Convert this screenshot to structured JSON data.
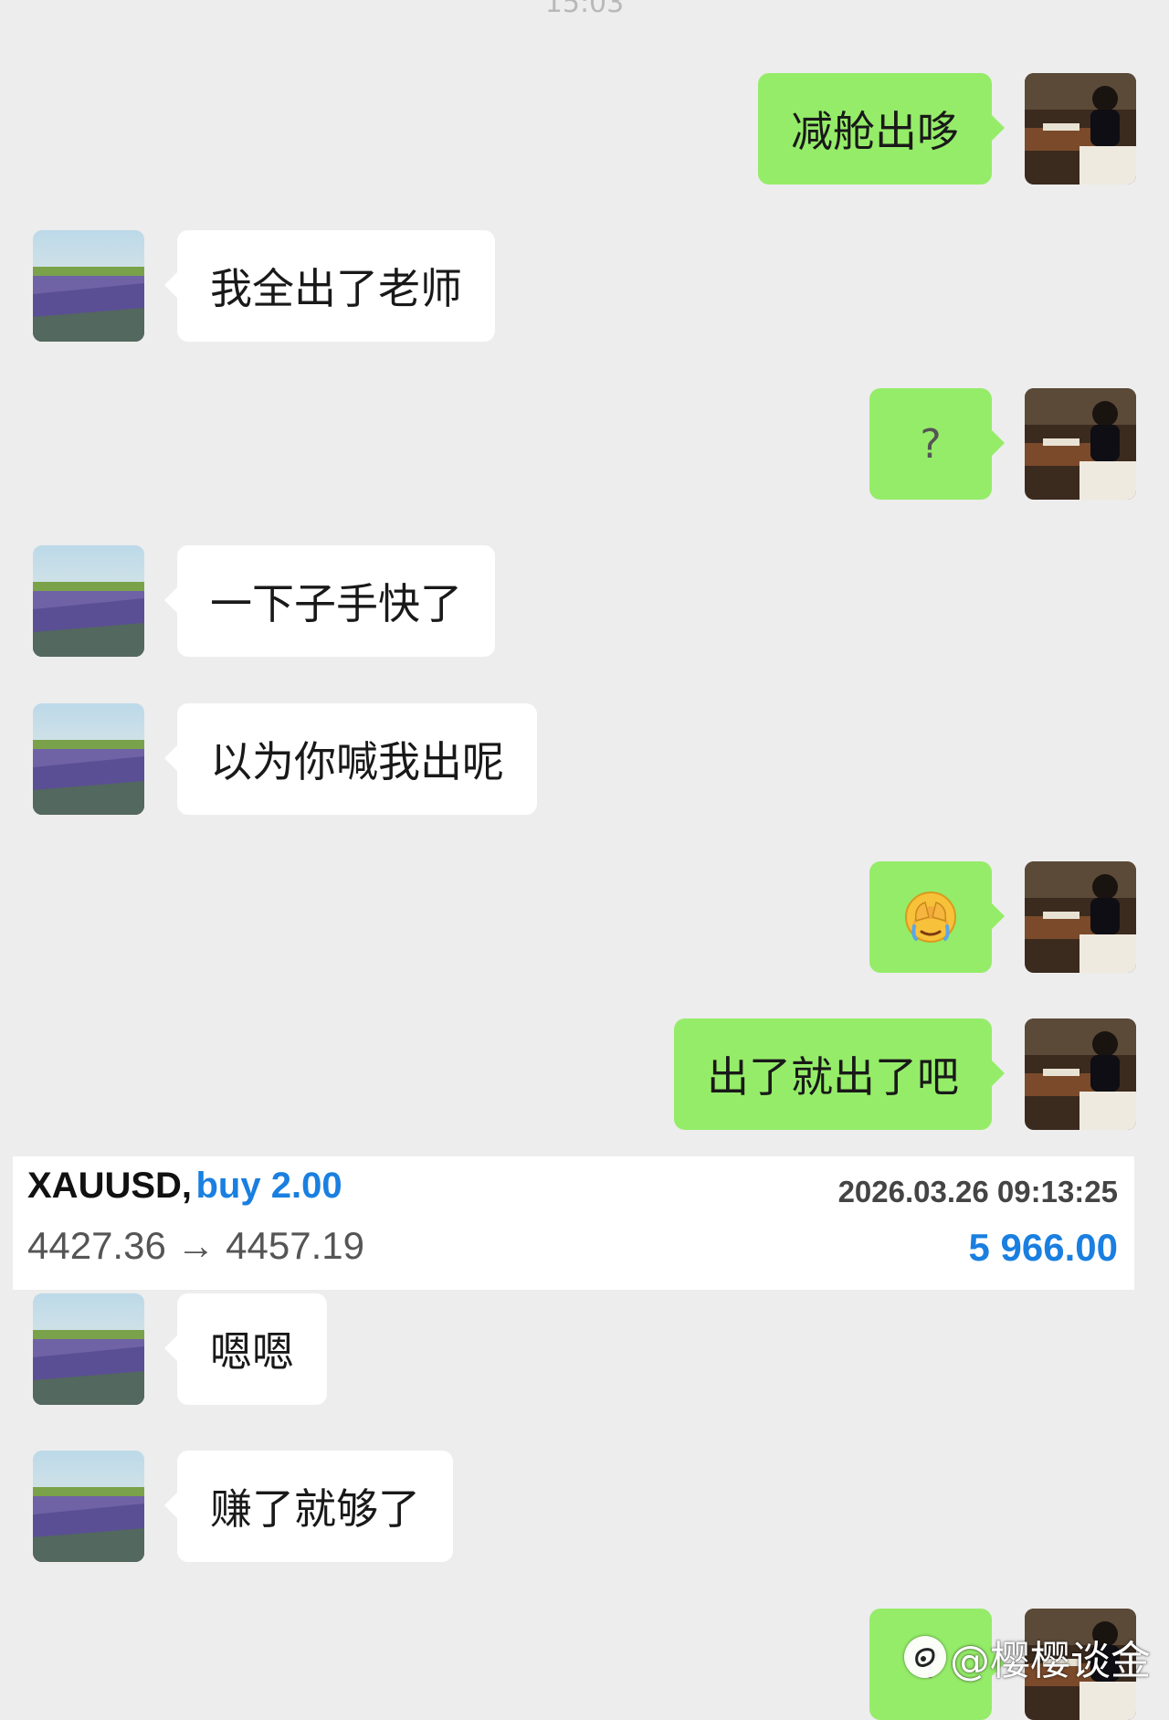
{
  "chat": {
    "timestamp": "15:03",
    "messages": [
      {
        "side": "right",
        "text": "减舱出哆"
      },
      {
        "side": "left",
        "text": "我全出了老师"
      },
      {
        "side": "right",
        "text": "?"
      },
      {
        "side": "left",
        "text": "一下子手快了"
      },
      {
        "side": "left",
        "text": "以为你喊我出呢"
      },
      {
        "side": "right",
        "emoji": "face-palm-emoji"
      },
      {
        "side": "right",
        "text": "出了就出了吧"
      },
      {
        "side": "left",
        "text": "嗯嗯"
      },
      {
        "side": "left",
        "text": "赚了就够了"
      },
      {
        "side": "right",
        "text": "?"
      }
    ]
  },
  "trade": {
    "symbol": "XAUUSD,",
    "side": "buy 2.00",
    "datetime": "2026.03.26 09:13:25",
    "prices": "4427.36 → 4457.19",
    "profit": "5 966.00",
    "colors": {
      "accent": "#1a7fe0"
    }
  },
  "watermark": {
    "text": "@樱樱谈金",
    "icon": "weibo-logo-icon"
  },
  "colors": {
    "background": "#ededed",
    "outgoing_bubble": "#95ec69",
    "incoming_bubble": "#ffffff"
  }
}
